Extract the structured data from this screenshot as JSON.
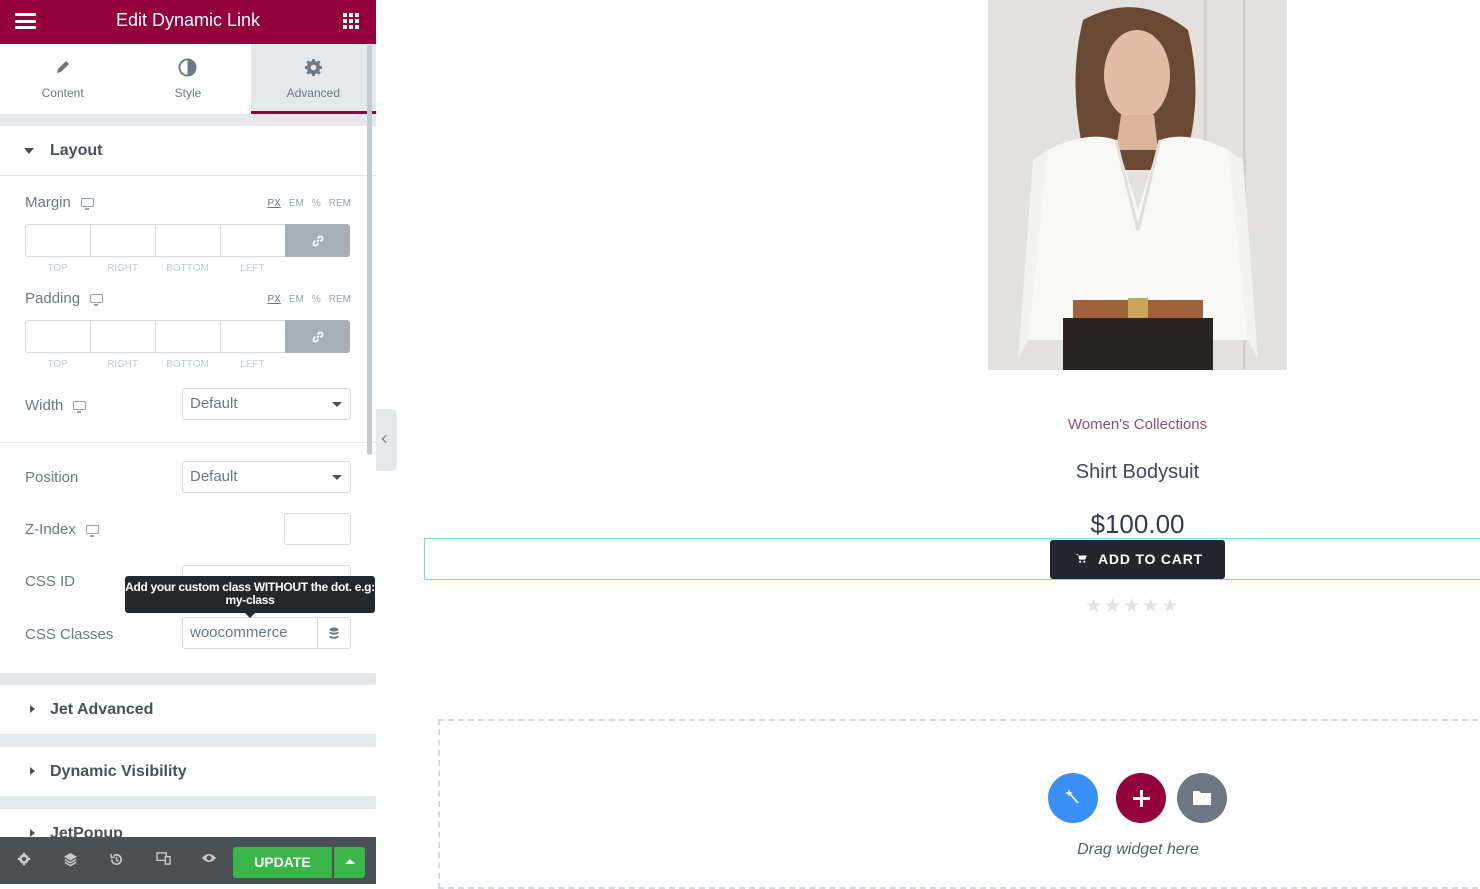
{
  "panel": {
    "title": "Edit Dynamic Link",
    "tabs": [
      {
        "label": "Content",
        "icon": "pencil-icon"
      },
      {
        "label": "Style",
        "icon": "contrast-icon"
      },
      {
        "label": "Advanced",
        "icon": "gear-icon",
        "active": true
      }
    ],
    "layout": {
      "title": "Layout",
      "margin": {
        "label": "Margin",
        "units": [
          "PX",
          "EM",
          "%",
          "REM"
        ],
        "selected_unit": "PX",
        "sides": [
          "TOP",
          "RIGHT",
          "BOTTOM",
          "LEFT"
        ]
      },
      "padding": {
        "label": "Padding",
        "units": [
          "PX",
          "EM",
          "%",
          "REM"
        ],
        "selected_unit": "PX",
        "sides": [
          "TOP",
          "RIGHT",
          "BOTTOM",
          "LEFT"
        ]
      },
      "width": {
        "label": "Width",
        "value": "Default"
      },
      "position": {
        "label": "Position",
        "value": "Default"
      },
      "z_index": {
        "label": "Z-Index",
        "value": ""
      },
      "css_id": {
        "label": "CSS ID",
        "value": ""
      },
      "css_classes": {
        "label": "CSS Classes",
        "value": "woocommerce"
      },
      "tooltip": "Add your custom class WITHOUT the dot. e.g: my-class"
    },
    "sections": [
      {
        "title": "Jet Advanced"
      },
      {
        "title": "Dynamic Visibility"
      },
      {
        "title": "JetPopup"
      }
    ],
    "footer": {
      "update_label": "UPDATE",
      "icons": [
        "settings-icon",
        "layers-icon",
        "history-icon",
        "responsive-icon",
        "preview-eye-icon"
      ]
    }
  },
  "canvas": {
    "product": {
      "category": "Women's Collections",
      "title": "Shirt Bodysuit",
      "price": "$100.00",
      "add_to_cart": "ADD TO CART",
      "rating": 0,
      "rating_max": 5
    },
    "drop_zone": {
      "text": "Drag widget here"
    }
  },
  "colors": {
    "brand": "#93003c",
    "update_green": "#39b54a",
    "panel_bg": "#e6e9ec",
    "magic_blue": "#3a8ff5",
    "folder_gray": "#6d7882",
    "category_purple": "#8b4f7a"
  }
}
